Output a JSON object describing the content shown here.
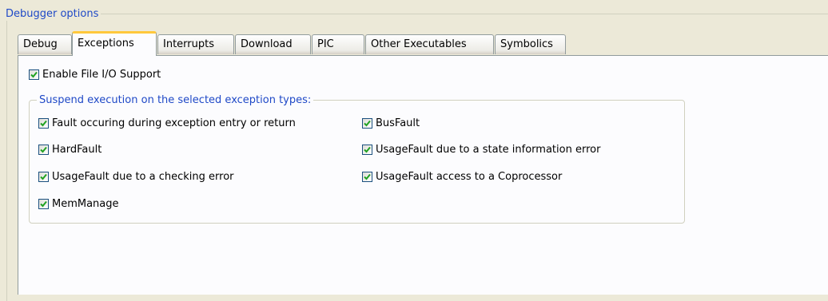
{
  "groupbox": {
    "title": "Debugger options"
  },
  "tabs": [
    {
      "label": "Debug"
    },
    {
      "label": "Exceptions"
    },
    {
      "label": "Interrupts"
    },
    {
      "label": "Download"
    },
    {
      "label": "PIC"
    },
    {
      "label": "Other Executables"
    },
    {
      "label": "Symbolics"
    }
  ],
  "active_tab": "Exceptions",
  "enable_file_io": {
    "label": "Enable File I/O Support",
    "checked": true
  },
  "exceptions_group": {
    "title": "Suspend execution on the selected exception types:",
    "items": [
      {
        "label": "Fault occuring during exception entry or return",
        "checked": true
      },
      {
        "label": "BusFault",
        "checked": true
      },
      {
        "label": "HardFault",
        "checked": true
      },
      {
        "label": "UsageFault due to a state information error",
        "checked": true
      },
      {
        "label": "UsageFault due to a checking error",
        "checked": true
      },
      {
        "label": "UsageFault access to a Coprocessor",
        "checked": true
      },
      {
        "label": "MemManage",
        "checked": true
      }
    ]
  },
  "colors": {
    "accent": "#1f49c7",
    "check": "#21a121",
    "active_tab_highlight": "#ffc83c"
  }
}
